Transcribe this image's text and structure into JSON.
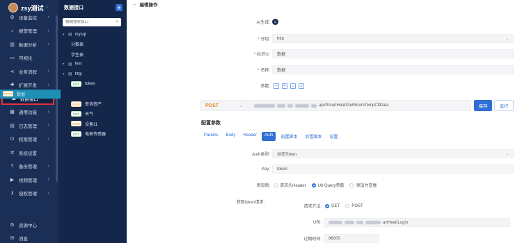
{
  "user": {
    "name": "zsy测试"
  },
  "sidebar": {
    "items": [
      {
        "label": "设备监控",
        "icon": "gear-icon",
        "arrow": true
      },
      {
        "label": "报警管理",
        "icon": "bell-icon",
        "arrow": true
      },
      {
        "label": "数据分析",
        "icon": "chart-icon",
        "arrow": true
      },
      {
        "label": "可视化",
        "icon": "monitor-icon",
        "arrow": false
      },
      {
        "label": "业务流程",
        "icon": "share-icon",
        "arrow": true
      },
      {
        "label": "扩展开发",
        "icon": "puzzle-icon",
        "arrow": true
      },
      {
        "label": "数据接口",
        "icon": "cloud-icon",
        "arrow": false,
        "active": true
      },
      {
        "label": "通用功能",
        "icon": "grid-icon",
        "arrow": true
      },
      {
        "label": "日志管理",
        "icon": "log-icon",
        "arrow": true
      },
      {
        "label": "权限管理",
        "icon": "lock-icon",
        "arrow": true
      },
      {
        "label": "系统设置",
        "icon": "settings-icon",
        "arrow": false
      },
      {
        "label": "备份管理",
        "icon": "backup-icon",
        "arrow": true
      },
      {
        "label": "视频管理",
        "icon": "video-icon",
        "arrow": true
      },
      {
        "label": "授权管理",
        "icon": "key-icon",
        "arrow": true
      }
    ],
    "footer": [
      {
        "label": "资源中心",
        "icon": "resource-icon"
      },
      {
        "label": "消息",
        "icon": "message-icon"
      }
    ]
  },
  "panel2": {
    "title": "数据接口",
    "search_placeholder": "模糊搜索接口",
    "tree": [
      {
        "label": "mysql",
        "type": "folder",
        "open": true,
        "level": 0
      },
      {
        "label": "分数表",
        "type": "item",
        "level": 1
      },
      {
        "label": "学生表",
        "type": "item",
        "level": 1
      },
      {
        "label": "test",
        "type": "folder",
        "open": false,
        "level": 0
      },
      {
        "label": "http",
        "type": "folder",
        "open": true,
        "level": 0
      },
      {
        "label": "token",
        "method": "GET",
        "level": 1
      },
      {
        "label": "数据",
        "method": "POST",
        "level": 1,
        "selected": true
      },
      {
        "label": "查询资产",
        "method": "POST",
        "level": 1
      },
      {
        "label": "天气",
        "method": "GET",
        "level": 1
      },
      {
        "label": "设备11",
        "method": "POST",
        "level": 1
      },
      {
        "label": "电表传感器",
        "method": "GET",
        "level": 1
      }
    ]
  },
  "main": {
    "breadcrumb": "编辑操作",
    "ai_label": "AI生成:",
    "group": {
      "label": "分组:",
      "value": "http"
    },
    "ident": {
      "label": "标识①:",
      "value": "数据"
    },
    "name": {
      "label": "名称:",
      "value": "数据"
    },
    "params_label": "参数:",
    "method": "POST",
    "url": "api/SmartHeat/GetRoomTempCtlData",
    "save_label": "保存",
    "run_label": "运行",
    "config_title": "配置参数",
    "tabs": [
      "Params",
      "Body",
      "Header",
      "Auth",
      "前置脚本",
      "后置脚本",
      "设置"
    ],
    "auth_type": {
      "label": "Auth类型:",
      "value": "动态Token"
    },
    "key": {
      "label": "Key:",
      "value": "token"
    },
    "add_to": {
      "label": "添加到:",
      "options": [
        "请求头Header",
        "Url Query参数",
        "添加为变量"
      ],
      "selected": 1
    },
    "token_req_label": "获取token请求:",
    "req_method": {
      "label": "请求方法:",
      "options": [
        "GET",
        "POST"
      ],
      "selected": 0
    },
    "uri": {
      "label": "URI:",
      "value": "artHeat/Login"
    },
    "expire": {
      "label": "过期时间:",
      "value": "86000"
    }
  }
}
